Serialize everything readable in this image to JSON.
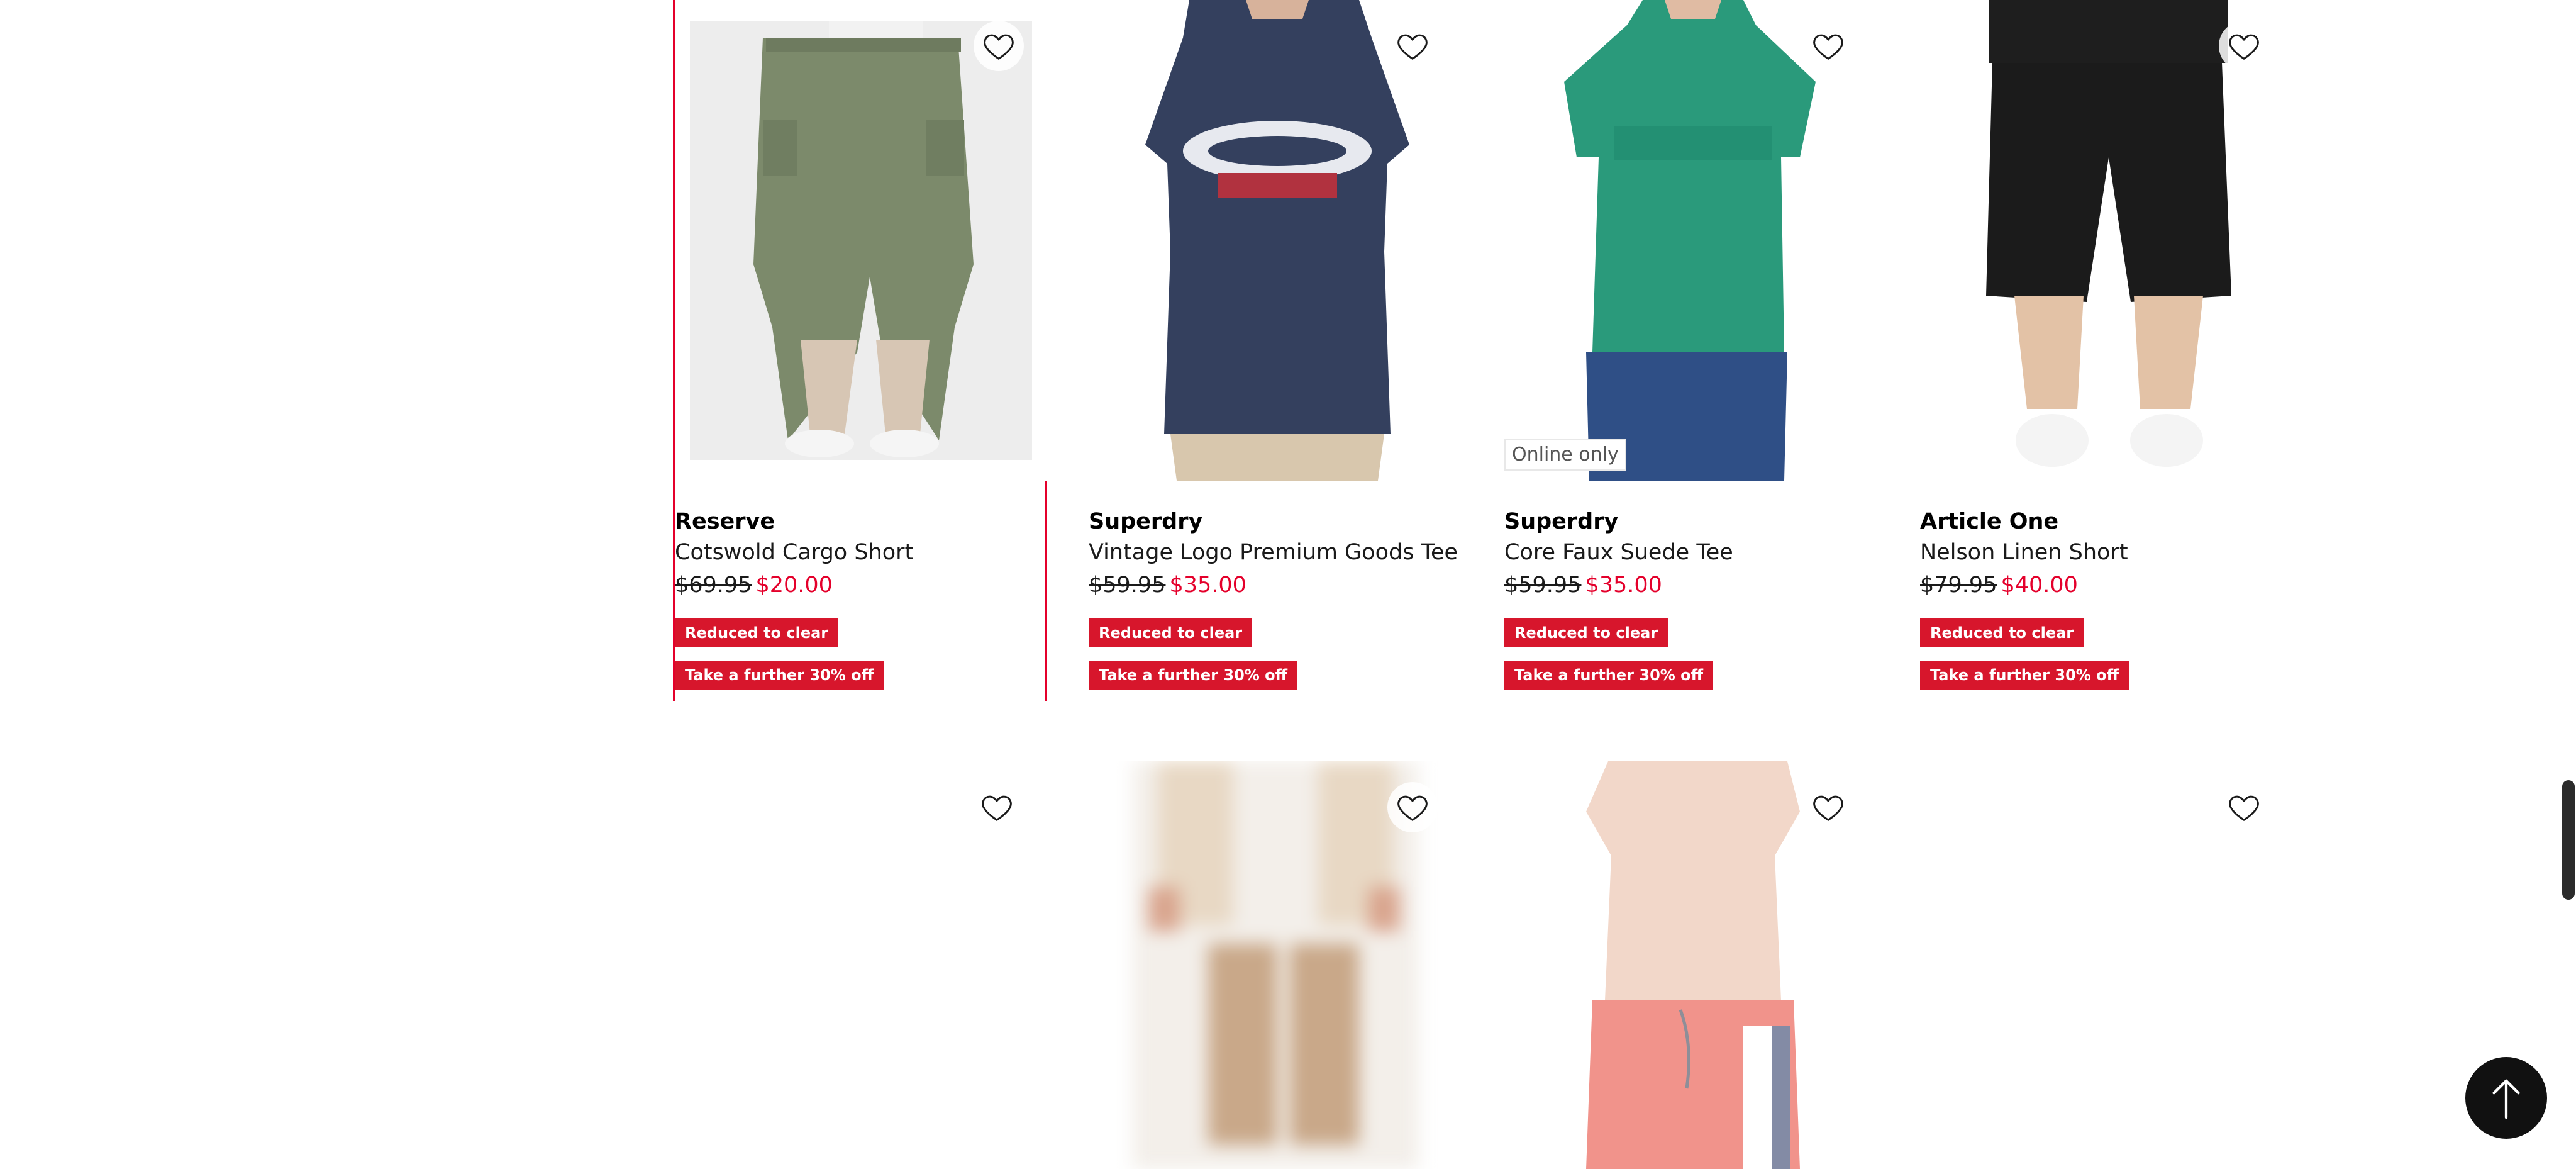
{
  "products_row1": [
    {
      "brand": "Reserve",
      "name": "Cotswold Cargo Short",
      "was": "$69.95",
      "now": "$20.00",
      "badge1": "Reduced to clear",
      "badge2": "Take a further 30% off"
    },
    {
      "brand": "Superdry",
      "name": "Vintage Logo Premium Goods Tee",
      "was": "$59.95",
      "now": "$35.00",
      "badge1": "Reduced to clear",
      "badge2": "Take a further 30% off"
    },
    {
      "brand": "Superdry",
      "name": "Core Faux Suede Tee",
      "was": "$59.95",
      "now": "$35.00",
      "badge1": "Reduced to clear",
      "badge2": "Take a further 30% off",
      "online_badge": "Online only"
    },
    {
      "brand": "Article One",
      "name": "Nelson Linen Short",
      "was": "$79.95",
      "now": "$40.00",
      "badge1": "Reduced to clear",
      "badge2": "Take a further 30% off"
    }
  ],
  "icons": {
    "favourite": "heart-outline-icon",
    "back_to_top": "arrow-up-icon"
  },
  "colors": {
    "accent_red": "#e4002b",
    "badge_red": "#d7162c",
    "back_to_top_bg": "#111111"
  }
}
